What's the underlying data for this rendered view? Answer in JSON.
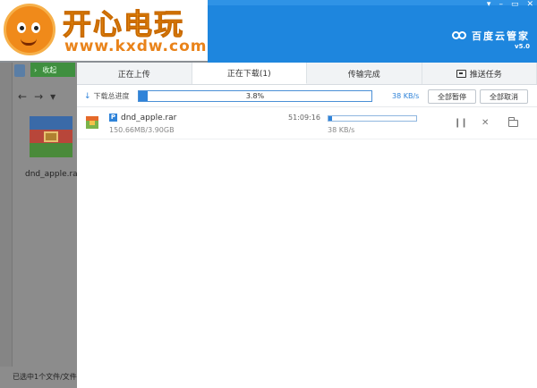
{
  "watermark": {
    "title": "开心电玩",
    "url": "www.kxdw.com"
  },
  "background_explorer": {
    "collapse_label": "收起",
    "file_name": "dnd_apple.rar",
    "status_text": "已选中1个文件/文件"
  },
  "header": {
    "brand_name": "百度云管家",
    "version": "v5.0",
    "window_controls": [
      "▾",
      "–",
      "▭",
      "✕"
    ],
    "accent_color": "#1e86de"
  },
  "tabs": [
    {
      "label": "正在上传",
      "active": false
    },
    {
      "label": "正在下载(1)",
      "active": true
    },
    {
      "label": "传输完成",
      "active": false
    },
    {
      "label": "推送任务",
      "active": false,
      "icon": "push-icon"
    }
  ],
  "summary": {
    "label": "下载总进度",
    "progress_text": "3.8%",
    "progress": 0.038,
    "speed": "38 KB/s",
    "pause_all": "全部暂停",
    "cancel_all": "全部取消"
  },
  "downloads": [
    {
      "name": "dnd_apple.rar",
      "size": "150.66MB/3.90GB",
      "time_left": "51:09:16",
      "progress": 0.04,
      "speed": "38 KB/s"
    }
  ]
}
